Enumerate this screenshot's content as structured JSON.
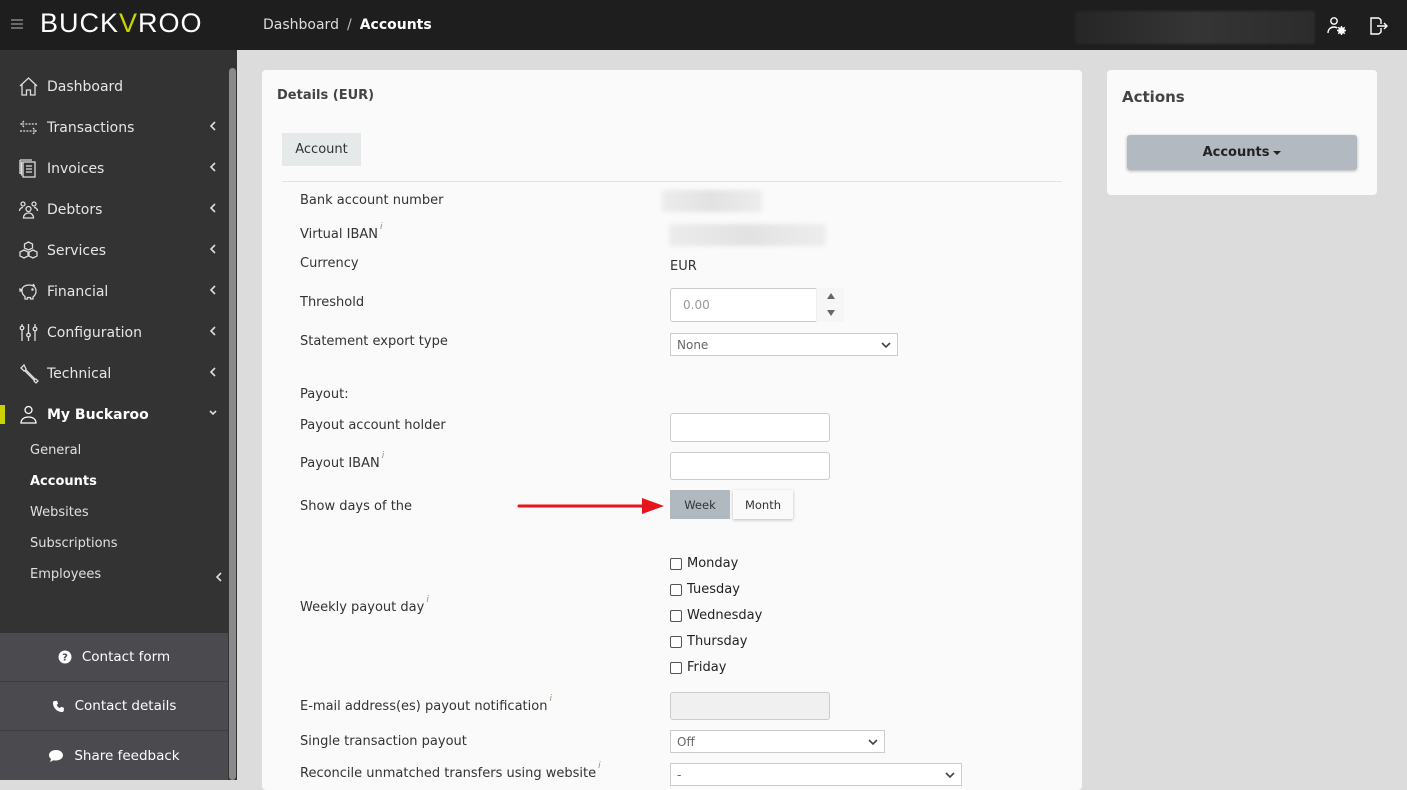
{
  "header": {
    "logo_left": "BUCK",
    "logo_accent": "V",
    "logo_right": "ROO",
    "breadcrumb": [
      "Dashboard",
      "Accounts"
    ],
    "breadcrumb_sep": "/",
    "icons": [
      "user-settings-icon",
      "logout-icon"
    ]
  },
  "sidebar": {
    "items": [
      {
        "label": "Dashboard",
        "icon": "home-icon",
        "expandable": false
      },
      {
        "label": "Transactions",
        "icon": "transfer-arrows-icon",
        "expandable": true
      },
      {
        "label": "Invoices",
        "icon": "invoices-icon",
        "expandable": true
      },
      {
        "label": "Debtors",
        "icon": "users-icon",
        "expandable": true
      },
      {
        "label": "Services",
        "icon": "boxes-icon",
        "expandable": true
      },
      {
        "label": "Financial",
        "icon": "piggy-bank-icon",
        "expandable": true
      },
      {
        "label": "Configuration",
        "icon": "sliders-icon",
        "expandable": true
      },
      {
        "label": "Technical",
        "icon": "wrench-icon",
        "expandable": true
      },
      {
        "label": "My Buckaroo",
        "icon": "user-icon",
        "expandable": true,
        "expanded": true,
        "active": true
      }
    ],
    "subitems": [
      {
        "label": "General"
      },
      {
        "label": "Accounts",
        "active": true
      },
      {
        "label": "Websites"
      },
      {
        "label": "Subscriptions"
      },
      {
        "label": "Employees",
        "expandable": true
      }
    ],
    "contact": [
      {
        "label": "Contact form",
        "icon": "question-circle-icon"
      },
      {
        "label": "Contact details",
        "icon": "phone-icon"
      },
      {
        "label": "Share feedback",
        "icon": "speech-bubble-icon"
      }
    ],
    "accent_color": "#c8d400"
  },
  "details": {
    "title": "Details (EUR)",
    "tab": "Account",
    "fields": {
      "bank_account_number": "Bank account number",
      "virtual_iban": "Virtual IBAN",
      "currency": "Currency",
      "currency_value": "EUR",
      "threshold": "Threshold",
      "threshold_value": "0.00",
      "statement_export_type": "Statement export type",
      "statement_export_value": "None",
      "payout_heading": "Payout:",
      "payout_account_holder": "Payout account holder",
      "payout_account_holder_value": "",
      "payout_iban": "Payout IBAN",
      "payout_iban_value": "",
      "show_days_of_the": "Show days of the",
      "period_options": [
        "Week",
        "Month"
      ],
      "period_selected": "Week",
      "weekly_payout_day": "Weekly payout day",
      "weekdays": [
        {
          "label": "Monday",
          "checked": false
        },
        {
          "label": "Tuesday",
          "checked": false
        },
        {
          "label": "Wednesday",
          "checked": false
        },
        {
          "label": "Thursday",
          "checked": false
        },
        {
          "label": "Friday",
          "checked": false
        }
      ],
      "email_payout_notification": "E-mail address(es) payout notification",
      "email_payout_notification_value": "",
      "single_transaction_payout": "Single transaction payout",
      "single_transaction_payout_value": "Off",
      "reconcile_unmatched": "Reconcile unmatched transfers using website",
      "reconcile_unmatched_value": "-"
    },
    "info_marker": "i"
  },
  "actions": {
    "title": "Actions",
    "button": "Accounts"
  },
  "annotation": {
    "arrow_color": "#e8141b"
  }
}
